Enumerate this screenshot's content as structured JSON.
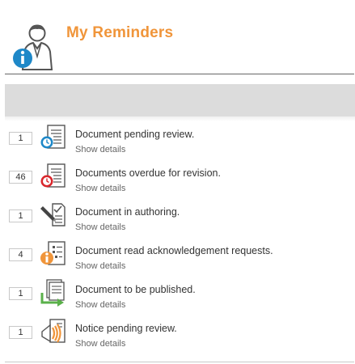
{
  "header": {
    "title": "My Reminders",
    "title_color": "#f0953a",
    "icon": "user-info-icon"
  },
  "reminders": [
    {
      "count": "1",
      "title": "Document pending review.",
      "details_label": "Show details",
      "icon": "clock-blue-document-icon"
    },
    {
      "count": "46",
      "title": "Documents overdue for revision.",
      "details_label": "Show details",
      "icon": "clock-red-document-icon"
    },
    {
      "count": "1",
      "title": "Document in authoring.",
      "details_label": "Show details",
      "icon": "pen-checklist-icon"
    },
    {
      "count": "4",
      "title": "Document read acknowledgement requests.",
      "details_label": "Show details",
      "icon": "info-document-icon"
    },
    {
      "count": "1",
      "title": "Document to be published.",
      "details_label": "Show details",
      "icon": "publish-document-icon"
    },
    {
      "count": "1",
      "title": "Notice pending review.",
      "details_label": "Show details",
      "icon": "megaphone-notice-icon"
    }
  ],
  "colors": {
    "accent_orange": "#f0953a",
    "info_blue": "#1e88c8",
    "overdue_red": "#d9262c",
    "publish_green": "#5ab04a"
  }
}
